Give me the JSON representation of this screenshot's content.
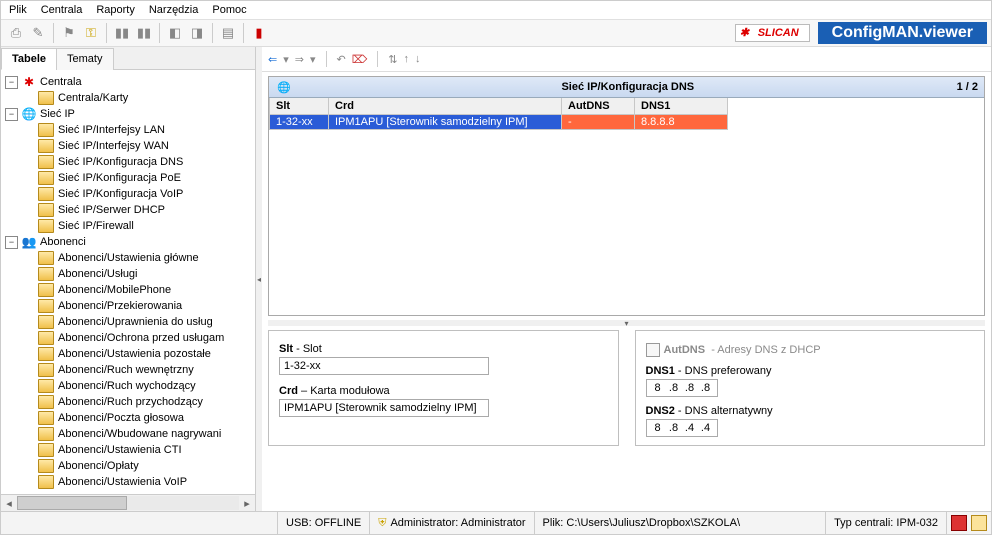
{
  "menu": [
    "Plik",
    "Centrala",
    "Raporty",
    "Narzędzia",
    "Pomoc"
  ],
  "brand": {
    "logo": "SLICAN",
    "app": "ConfigMAN.viewer"
  },
  "left": {
    "tabs": [
      "Tabele",
      "Tematy"
    ],
    "active_tab": 0,
    "tree": [
      {
        "icon": "red",
        "label": "Centrala",
        "exp": "-",
        "children": [
          {
            "icon": "fold",
            "label": "Centrala/Karty"
          }
        ]
      },
      {
        "icon": "globe",
        "label": "Sieć IP",
        "exp": "-",
        "children": [
          {
            "icon": "fold",
            "label": "Sieć IP/Interfejsy LAN"
          },
          {
            "icon": "fold",
            "label": "Sieć IP/Interfejsy WAN"
          },
          {
            "icon": "fold",
            "label": "Sieć IP/Konfiguracja DNS",
            "sel": true
          },
          {
            "icon": "fold",
            "label": "Sieć IP/Konfiguracja PoE"
          },
          {
            "icon": "fold",
            "label": "Sieć IP/Konfiguracja VoIP"
          },
          {
            "icon": "fold",
            "label": "Sieć IP/Serwer DHCP"
          },
          {
            "icon": "fold",
            "label": "Sieć IP/Firewall"
          }
        ]
      },
      {
        "icon": "users",
        "label": "Abonenci",
        "exp": "-",
        "children": [
          {
            "icon": "fold",
            "label": "Abonenci/Ustawienia główne"
          },
          {
            "icon": "fold",
            "label": "Abonenci/Usługi"
          },
          {
            "icon": "fold",
            "label": "Abonenci/MobilePhone"
          },
          {
            "icon": "fold",
            "label": "Abonenci/Przekierowania"
          },
          {
            "icon": "fold",
            "label": "Abonenci/Uprawnienia do usług"
          },
          {
            "icon": "fold",
            "label": "Abonenci/Ochrona przed usługam"
          },
          {
            "icon": "fold",
            "label": "Abonenci/Ustawienia pozostałe"
          },
          {
            "icon": "fold",
            "label": "Abonenci/Ruch wewnętrzny"
          },
          {
            "icon": "fold",
            "label": "Abonenci/Ruch wychodzący"
          },
          {
            "icon": "fold",
            "label": "Abonenci/Ruch przychodzący"
          },
          {
            "icon": "fold",
            "label": "Abonenci/Poczta głosowa"
          },
          {
            "icon": "fold",
            "label": "Abonenci/Wbudowane nagrywani"
          },
          {
            "icon": "fold",
            "label": "Abonenci/Ustawienia CTI"
          },
          {
            "icon": "fold",
            "label": "Abonenci/Opłaty"
          },
          {
            "icon": "fold",
            "label": "Abonenci/Ustawienia VoIP"
          }
        ]
      }
    ]
  },
  "main": {
    "title": "Sieć IP/Konfiguracja DNS",
    "counter": "1 / 2",
    "cols": [
      "Slt",
      "Crd",
      "AutDNS",
      "DNS1"
    ],
    "rows": [
      {
        "slt": "1-32-xx",
        "crd": "IPM1APU [Sterownik samodzielny IPM]",
        "aut": "-",
        "dns1": "8.8.8.8"
      }
    ],
    "form": {
      "slt_lbl": "Slt",
      "slt_desc": "- Slot",
      "slt_val": "1-32-xx",
      "crd_lbl": "Crd",
      "crd_desc": "– Karta modułowa",
      "crd_val": "IPM1APU [Sterownik samodzielny IPM]",
      "aut_lbl": "AutDNS",
      "aut_desc": "- Adresy DNS z DHCP",
      "dns1_lbl": "DNS1",
      "dns1_desc": "- DNS preferowany",
      "dns1_val": [
        "8",
        ".8",
        ".8",
        ".8"
      ],
      "dns2_lbl": "DNS2",
      "dns2_desc": "- DNS alternatywny",
      "dns2_val": [
        "8",
        ".8",
        ".4",
        ".4"
      ]
    }
  },
  "status": {
    "usb": "USB: OFFLINE",
    "admin": "Administrator: Administrator",
    "file": "Plik: C:\\Users\\Juliusz\\Dropbox\\SZKOLA\\",
    "type": "Typ centrali: IPM-032"
  }
}
